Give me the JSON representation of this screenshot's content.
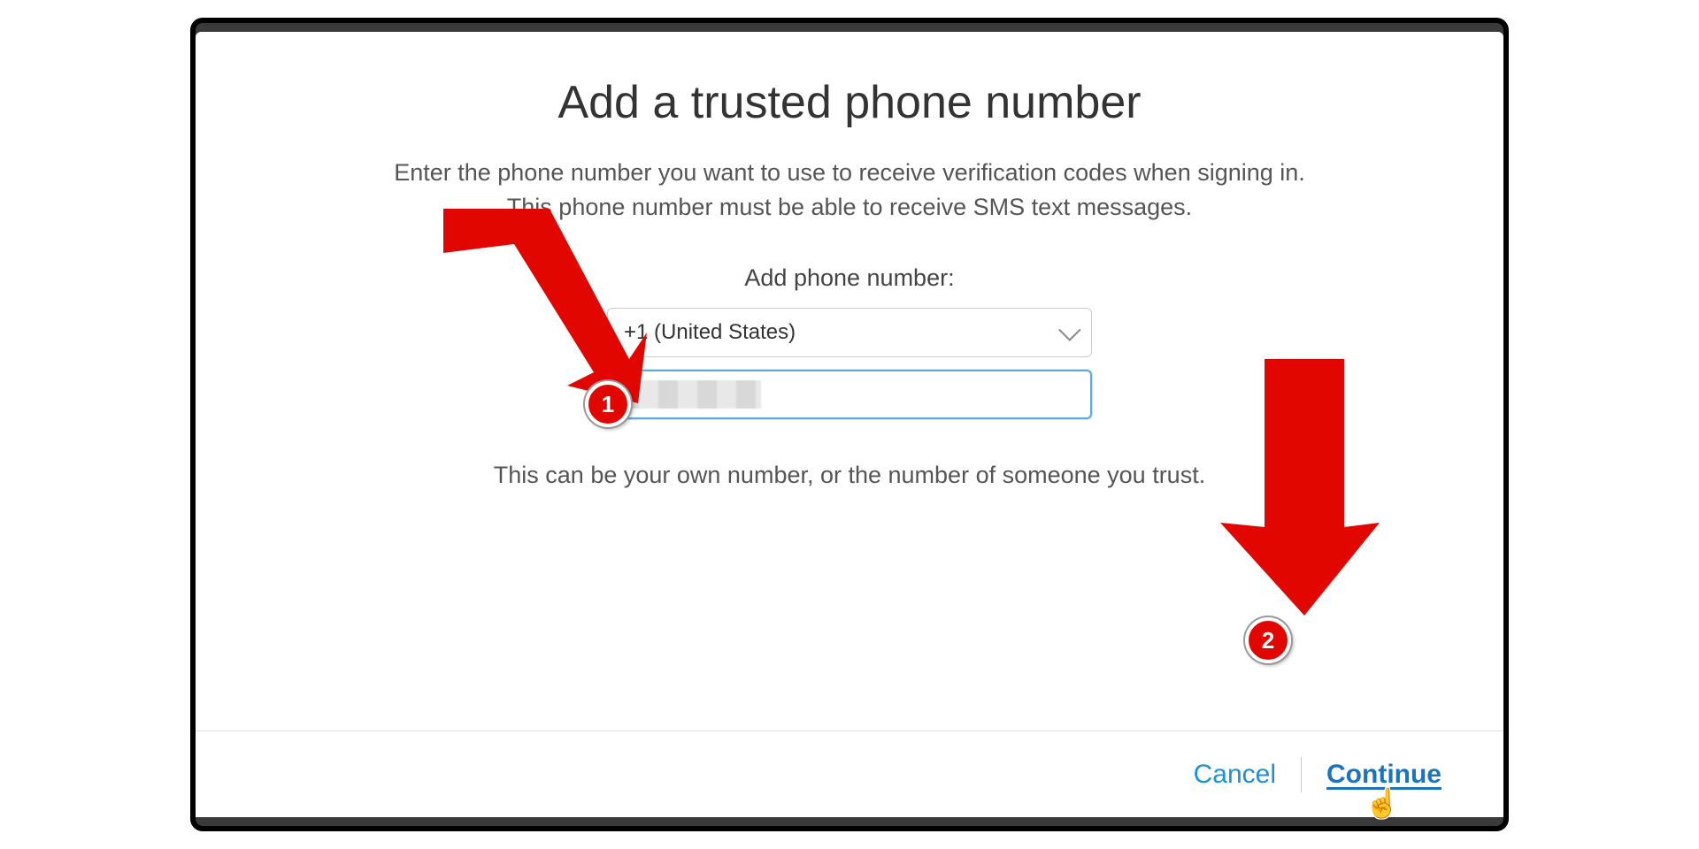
{
  "dialog": {
    "title": "Add a trusted phone number",
    "description": "Enter the phone number you want to use to receive verification codes when signing in. This phone number must be able to receive SMS text messages.",
    "field_label": "Add phone number:",
    "country_code_selected": "+1 (United States)",
    "phone_value_redacted": true,
    "hint": "This can be your own number, or the number of someone you trust.",
    "cancel_label": "Cancel",
    "continue_label": "Continue"
  },
  "annotations": {
    "badge_1": "1",
    "badge_2": "2"
  },
  "colors": {
    "accent_red": "#e10600",
    "link_blue": "#1e73be",
    "link_blue_light": "#1e90d6",
    "input_focus_border": "#5fa9df"
  }
}
